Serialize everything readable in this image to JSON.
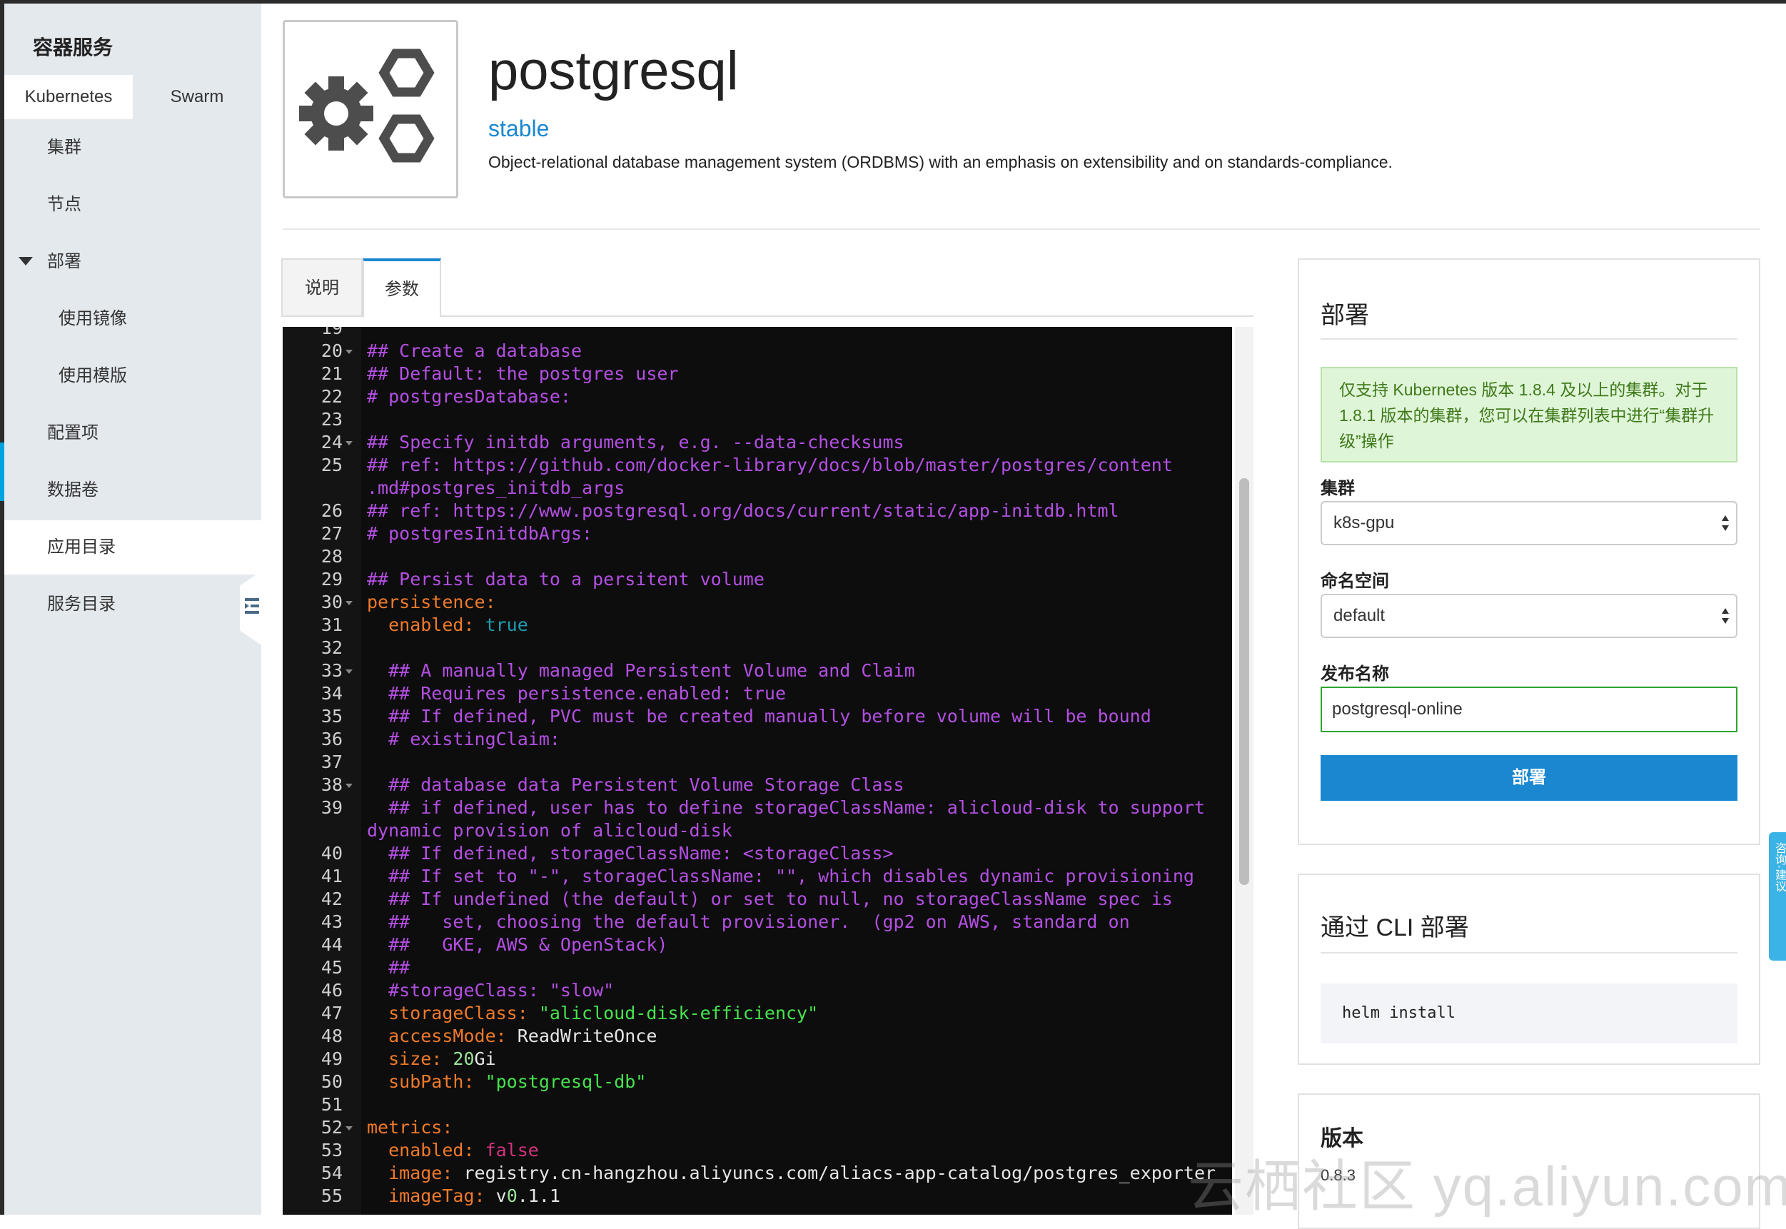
{
  "colors": {
    "accent": "#1a87d0",
    "sidebar_bg": "#e4e9ee",
    "notice_bg": "#dff5d8",
    "notice_text": "#3f7a1a",
    "active_input_border": "#2ea52e",
    "editor_bg": "#0d0d0d"
  },
  "sidebar": {
    "title": "容器服务",
    "tabs": [
      {
        "label": "Kubernetes",
        "active": true
      },
      {
        "label": "Swarm",
        "active": false
      }
    ],
    "items": [
      {
        "label": "集群"
      },
      {
        "label": "节点"
      },
      {
        "label": "部署",
        "expanded": true
      },
      {
        "label": "使用镜像",
        "sub": true
      },
      {
        "label": "使用模版",
        "sub": true
      },
      {
        "label": "配置项"
      },
      {
        "label": "数据卷"
      },
      {
        "label": "应用目录",
        "selected": true
      },
      {
        "label": "服务目录"
      }
    ],
    "collapse_icon": "collapse-sidebar-icon"
  },
  "header": {
    "logo_icon": "gears-hexagon-logo-icon",
    "title": "postgresql",
    "tag": "stable",
    "description": "Object-relational database management system (ORDBMS) with an emphasis on extensibility and on standards-compliance."
  },
  "tabs": [
    {
      "label": "说明",
      "active": false
    },
    {
      "label": "参数",
      "active": true
    }
  ],
  "editor": {
    "lines": [
      {
        "n": "19",
        "fold": false,
        "seg": []
      },
      {
        "n": "20",
        "fold": true,
        "seg": [
          [
            "c",
            "## Create a database"
          ]
        ]
      },
      {
        "n": "21",
        "fold": false,
        "seg": [
          [
            "c",
            "## Default: the postgres user"
          ]
        ]
      },
      {
        "n": "22",
        "fold": false,
        "seg": [
          [
            "c",
            "# postgresDatabase:"
          ]
        ]
      },
      {
        "n": "23",
        "fold": false,
        "seg": []
      },
      {
        "n": "24",
        "fold": true,
        "seg": [
          [
            "c",
            "## Specify initdb arguments, e.g. --data-checksums"
          ]
        ]
      },
      {
        "n": "25",
        "fold": false,
        "seg": [
          [
            "c",
            "## ref: https://github.com/docker-library/docs/blob/master/postgres/content"
          ]
        ]
      },
      {
        "n": "",
        "fold": false,
        "seg": [
          [
            "c",
            ".md#postgres_initdb_args"
          ]
        ]
      },
      {
        "n": "26",
        "fold": false,
        "seg": [
          [
            "c",
            "## ref: https://www.postgresql.org/docs/current/static/app-initdb.html"
          ]
        ]
      },
      {
        "n": "27",
        "fold": false,
        "seg": [
          [
            "c",
            "# postgresInitdbArgs:"
          ]
        ]
      },
      {
        "n": "28",
        "fold": false,
        "seg": []
      },
      {
        "n": "29",
        "fold": false,
        "seg": [
          [
            "c",
            "## Persist data to a persitent volume"
          ]
        ]
      },
      {
        "n": "30",
        "fold": true,
        "seg": [
          [
            "k",
            "persistence:"
          ]
        ]
      },
      {
        "n": "31",
        "fold": false,
        "seg": [
          [
            "k",
            "  enabled: "
          ],
          [
            "t",
            "true"
          ]
        ]
      },
      {
        "n": "32",
        "fold": false,
        "seg": []
      },
      {
        "n": "33",
        "fold": true,
        "seg": [
          [
            "c",
            "  ## A manually managed Persistent Volume and Claim"
          ]
        ]
      },
      {
        "n": "34",
        "fold": false,
        "seg": [
          [
            "c",
            "  ## Requires persistence.enabled: true"
          ]
        ]
      },
      {
        "n": "35",
        "fold": false,
        "seg": [
          [
            "c",
            "  ## If defined, PVC must be created manually before volume will be bound"
          ]
        ]
      },
      {
        "n": "36",
        "fold": false,
        "seg": [
          [
            "c",
            "  # existingClaim:"
          ]
        ]
      },
      {
        "n": "37",
        "fold": false,
        "seg": []
      },
      {
        "n": "38",
        "fold": true,
        "seg": [
          [
            "c",
            "  ## database data Persistent Volume Storage Class"
          ]
        ]
      },
      {
        "n": "39",
        "fold": false,
        "seg": [
          [
            "c",
            "  ## if defined, user has to define storageClassName: alicloud-disk to support"
          ]
        ]
      },
      {
        "n": "",
        "fold": false,
        "seg": [
          [
            "c",
            "dynamic provision of alicloud-disk"
          ]
        ]
      },
      {
        "n": "40",
        "fold": false,
        "seg": [
          [
            "c",
            "  ## If defined, storageClassName: <storageClass>"
          ]
        ]
      },
      {
        "n": "41",
        "fold": false,
        "seg": [
          [
            "c",
            "  ## If set to \"-\", storageClassName: \"\", which disables dynamic provisioning"
          ]
        ]
      },
      {
        "n": "42",
        "fold": false,
        "seg": [
          [
            "c",
            "  ## If undefined (the default) or set to null, no storageClassName spec is"
          ]
        ]
      },
      {
        "n": "43",
        "fold": false,
        "seg": [
          [
            "c",
            "  ##   set, choosing the default provisioner.  (gp2 on AWS, standard on"
          ]
        ]
      },
      {
        "n": "44",
        "fold": false,
        "seg": [
          [
            "c",
            "  ##   GKE, AWS & OpenStack)"
          ]
        ]
      },
      {
        "n": "45",
        "fold": false,
        "seg": [
          [
            "c",
            "  ##"
          ]
        ]
      },
      {
        "n": "46",
        "fold": false,
        "seg": [
          [
            "c",
            "  #storageClass: \"slow\""
          ]
        ]
      },
      {
        "n": "47",
        "fold": false,
        "seg": [
          [
            "k",
            "  storageClass: "
          ],
          [
            "s",
            "\"alicloud-disk-efficiency\""
          ]
        ]
      },
      {
        "n": "48",
        "fold": false,
        "seg": [
          [
            "k",
            "  accessMode: "
          ],
          [
            "v",
            "ReadWriteOnce"
          ]
        ]
      },
      {
        "n": "49",
        "fold": false,
        "seg": [
          [
            "k",
            "  size: "
          ],
          [
            "num",
            "20"
          ],
          [
            "v",
            "Gi"
          ]
        ]
      },
      {
        "n": "50",
        "fold": false,
        "seg": [
          [
            "k",
            "  subPath: "
          ],
          [
            "s",
            "\"postgresql-db\""
          ]
        ]
      },
      {
        "n": "51",
        "fold": false,
        "seg": []
      },
      {
        "n": "52",
        "fold": true,
        "seg": [
          [
            "k",
            "metrics:"
          ]
        ]
      },
      {
        "n": "53",
        "fold": false,
        "seg": [
          [
            "k",
            "  enabled: "
          ],
          [
            "f",
            "false"
          ]
        ]
      },
      {
        "n": "54",
        "fold": false,
        "seg": [
          [
            "k",
            "  image: "
          ],
          [
            "v",
            "registry.cn-hangzhou.aliyuncs.com/aliacs-app-catalog/postgres_exporter"
          ]
        ]
      },
      {
        "n": "55",
        "fold": false,
        "seg": [
          [
            "k",
            "  imageTag: "
          ],
          [
            "v",
            "v"
          ],
          [
            "num",
            "0"
          ],
          [
            "v",
            ".1.1"
          ]
        ]
      }
    ]
  },
  "deploy_panel": {
    "title": "部署",
    "notice": "仅支持 Kubernetes 版本 1.8.4 及以上的集群。对于 1.8.1 版本的集群，您可以在集群列表中进行“集群升级”操作",
    "cluster_label": "集群",
    "cluster_value": "k8s-gpu",
    "namespace_label": "命名空间",
    "namespace_value": "default",
    "release_label": "发布名称",
    "release_value": "postgresql-online",
    "button": "部署"
  },
  "cli_panel": {
    "title": "通过 CLI 部署",
    "command": "helm install"
  },
  "version_panel": {
    "title": "版本",
    "value": "0.8.3"
  },
  "feedback": {
    "label": "咨询·建议"
  },
  "watermark": "云栖社区 yq.aliyun.com"
}
